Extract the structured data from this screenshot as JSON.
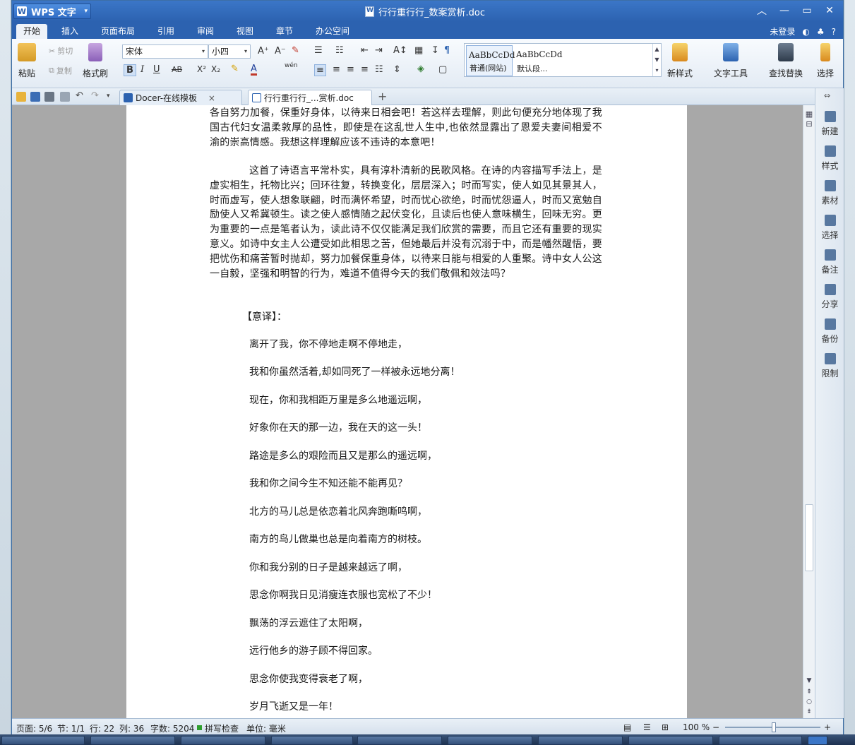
{
  "app": {
    "name": "WPS 文字",
    "doc_title": "行行重行行_数案赏析.doc"
  },
  "menu": {
    "tabs": [
      "开始",
      "插入",
      "页面布局",
      "引用",
      "审阅",
      "视图",
      "章节",
      "办公空间"
    ],
    "active": "开始",
    "login": "未登录",
    "help": "?"
  },
  "ribbon": {
    "paste": "粘贴",
    "cut": "剪切",
    "copy": "复制",
    "format_painter": "格式刷",
    "font_name": "宋体",
    "font_size": "小四",
    "bold": "B",
    "italic": "I",
    "underline": "U",
    "strike": "AB",
    "superscript": "X²",
    "subscript": "X₂",
    "font_color": "A",
    "pinyin": "wén",
    "style1_preview": "AaBbCcDd",
    "style1_label": "普通(网站)",
    "style2_preview": "AaBbCcDd",
    "style2_label": "默认段...",
    "new_style": "新样式",
    "text_tools": "文字工具",
    "find_replace": "查找替换",
    "select": "选择"
  },
  "doc_tabs": [
    {
      "label": "Docer-在线模板",
      "close": "×"
    },
    {
      "label": "行行重行行_...赏析.doc",
      "close": "×"
    }
  ],
  "doc_tab_add": "+",
  "content": {
    "para1": "各自努力加餐，保重好身体，以待来日相会吧！若这样去理解，则此句便充分地体现了我国古代妇女温柔敦厚的品性，即使是在这乱世人生中,也依然显露出了恩爱夫妻间相爱不渝的崇高情感。我想这样理解应该不违诗的本意吧！",
    "para2": "这首了诗语言平常朴实，具有淳朴清新的民歌风格。在诗的内容描写手法上，是虚实相生，托物比兴；回环往复，转换变化，层层深入；时而写实，使人如见其景其人，时而虚写，使人想象联翩，时而满怀希望，时而忧心欲绝，时而忧怨逼人，时而又宽勉自励使人又希冀顿生。读之使人感情随之起伏变化，且读后也使人意味横生，回味无穷。更为重要的一点是笔者认为，读此诗不仅仅能满足我们欣赏的需要，而且它还有重要的现实意义。如诗中女主人公遭受如此相思之苦，但她最后并没有沉溺于中，而是幡然醒悟，要把忧伤和痛苦暂时抛却，努力加餐保重身体，以待来日能与相爱的人重聚。诗中女人公这一自毅，坚强和明智的行为，难道不值得今天的我们敬佩和效法吗？",
    "heading": "【意译】：",
    "lines": [
      "离开了我，你不停地走啊不停地走，",
      "我和你虽然活着,却如同死了一样被永远地分离！",
      "现在，你和我相距万里是多么地遥远啊，",
      "好象你在天的那一边，我在天的这一头！",
      "路途是多么的艰险而且又是那么的遥远啊，",
      "我和你之间今生不知还能不能再见？",
      "北方的马儿总是依恋着北风奔跑嘶鸣啊，",
      "南方的鸟儿做巢也总是向着南方的树枝。",
      "  你和我分别的日子是越来越远了啊，",
      "思念你啊我日见消瘦连衣服也宽松了不少！",
      "飘荡的浮云遮住了太阳啊，",
      "远行他乡的游子顾不得回家。",
      "思念你使我变得衰老了啊，",
      "岁月飞逝又是一年！"
    ]
  },
  "sidebar": [
    "新建",
    "样式",
    "素材",
    "选择",
    "备注",
    "分享",
    "备份",
    "限制"
  ],
  "status": {
    "page": "页面: 5/6",
    "section": "节: 1/1",
    "row": "行: 22",
    "col": "列: 36",
    "words": "字数: 5204",
    "spell": "拼写检查",
    "unit": "单位: 毫米",
    "zoom": "100 %",
    "zoom_minus": "−",
    "zoom_plus": "+"
  },
  "colors": {
    "title_bar": "#2c62b0",
    "ribbon_bg": "#e3ebf4",
    "page_bg": "#ffffff",
    "doc_bg": "#a8a8a8"
  }
}
